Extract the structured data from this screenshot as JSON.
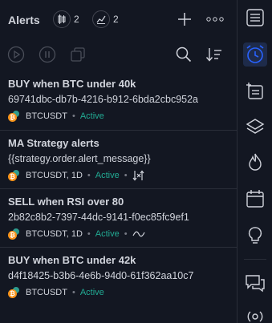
{
  "header": {
    "title": "Alerts",
    "active_count": "2",
    "triggered_count": "2"
  },
  "alerts": [
    {
      "name": "BUY when BTC under 40k",
      "message": "69741dbc-db7b-4216-b912-6bda2cbc952a",
      "symbol": "BTCUSDT",
      "status": "Active",
      "extra_icon": ""
    },
    {
      "name": "MA Strategy alerts",
      "message": "{{strategy.order.alert_message}}",
      "symbol": "BTCUSDT, 1D",
      "status": "Active",
      "extra_icon": "strategy-icon"
    },
    {
      "name": "SELL when RSI over 80",
      "message": "2b82c8b2-7397-44dc-9141-f0ec85fc9ef1",
      "symbol": "BTCUSDT, 1D",
      "status": "Active",
      "extra_icon": "indicator-wave-icon"
    },
    {
      "name": "BUY when BTC under 42k",
      "message": "d4f18425-b3b6-4e6b-94d0-61f362aa10c7",
      "symbol": "BTCUSDT",
      "status": "Active",
      "extra_icon": ""
    }
  ],
  "colors": {
    "background": "#131722",
    "text": "#d1d4dc",
    "status_active": "#22ab94",
    "accent": "#2962ff",
    "muted": "#787b86"
  },
  "rail_icons": [
    "menu-icon",
    "alarm-clock-icon",
    "add-list-icon",
    "layers-icon",
    "hotlist-flame-icon",
    "calendar-icon",
    "ideas-bulb-icon",
    "chat-icon",
    "broadcast-icon"
  ]
}
